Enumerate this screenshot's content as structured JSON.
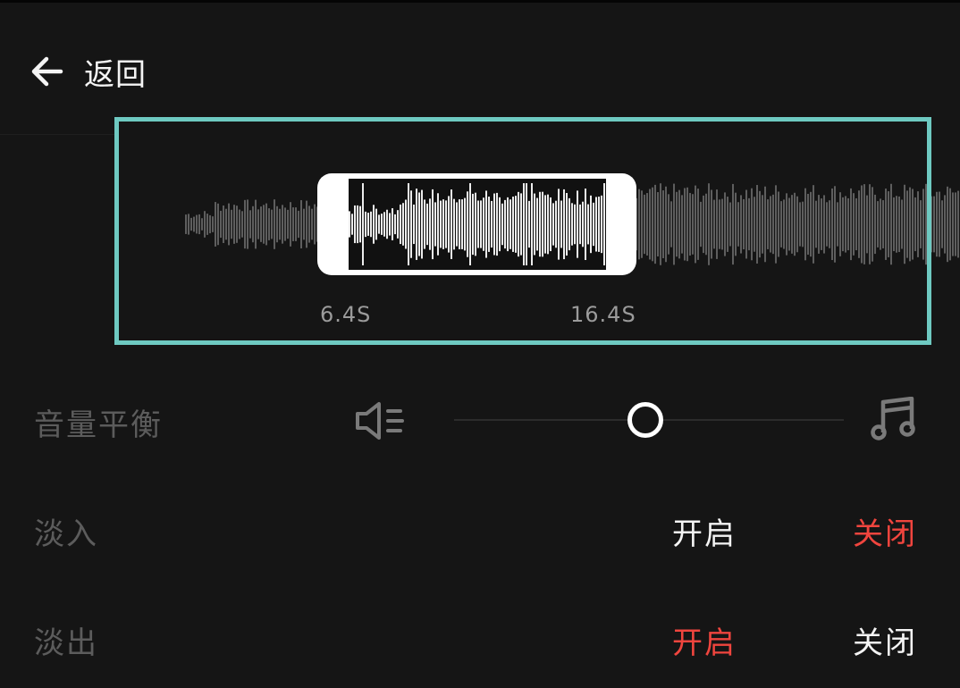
{
  "header": {
    "back_label": "返回",
    "back_icon": "arrow-left-icon"
  },
  "waveform": {
    "start_time": "6.4S",
    "end_time": "16.4S",
    "frame_color": "#6ec9c1",
    "selection_color": "#ffffff"
  },
  "volume_balance": {
    "label": "音量平衡",
    "left_icon": "speaker-icon",
    "right_icon": "music-note-icon",
    "level": 0.44
  },
  "fade_in": {
    "label": "淡入",
    "on_label": "开启",
    "off_label": "关闭",
    "selected": "off"
  },
  "fade_out": {
    "label": "淡出",
    "on_label": "开启",
    "off_label": "关闭",
    "selected": "on"
  },
  "colors": {
    "background": "#151515",
    "selected": "#f0453e",
    "unselected": "#f4f4f4",
    "label": "#5c5c5c"
  }
}
